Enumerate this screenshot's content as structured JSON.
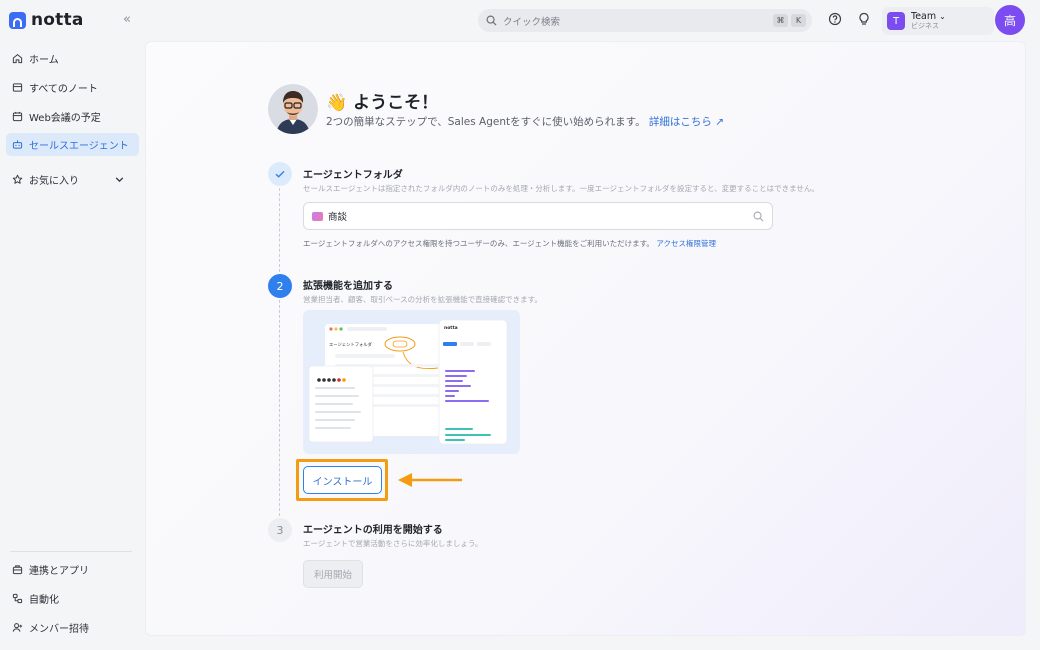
{
  "app": {
    "logo_text": "notta",
    "brand_color": "#3b6cf6",
    "accent_color": "#2f6fd8"
  },
  "topbar": {
    "search_placeholder": "クイック検索",
    "shortcut_keys": [
      "⌘",
      "K"
    ],
    "team_initial": "T",
    "team_name": "Team",
    "team_plan": "ビジネス",
    "user_initial": "高"
  },
  "sidebar": {
    "items": [
      {
        "label": "ホーム",
        "icon": "home-icon"
      },
      {
        "label": "すべてのノート",
        "icon": "notes-icon"
      },
      {
        "label": "Web会議の予定",
        "icon": "calendar-icon"
      },
      {
        "label": "セールスエージェント",
        "icon": "robot-icon",
        "active": true
      },
      {
        "label": "お気に入り",
        "icon": "star-icon"
      }
    ],
    "bottom_items": [
      {
        "label": "連携とアプリ",
        "icon": "apps-icon"
      },
      {
        "label": "自動化",
        "icon": "automation-icon"
      },
      {
        "label": "メンバー招待",
        "icon": "invite-icon"
      }
    ]
  },
  "main": {
    "welcome_title": "👋 ようこそ！",
    "welcome_subtitle": "2つの簡単なステップで、Sales Agentをすぐに使い始められます。",
    "welcome_link": "詳細はこちら ↗",
    "steps": [
      {
        "number": "✓",
        "title": "エージェントフォルダ",
        "desc": "セールスエージェントは指定されたフォルダ内のノートのみを処理・分析します。一度エージェントフォルダを設定すると、変更することはできません。",
        "folder_value": "商談",
        "access_note": "エージェントフォルダへのアクセス権限を持つユーザーのみ、エージェント機能をご利用いただけます。",
        "access_link": "アクセス権限管理"
      },
      {
        "number": "2",
        "title": "拡張機能を追加する",
        "desc": "営業担当者、顧客、取引ベースの分析を拡張機能で直接確認できます。",
        "install_label": "インストール",
        "preview": {
          "folder_label": "エージェントフォルダ",
          "panel_logo": "notta"
        }
      },
      {
        "number": "3",
        "title": "エージェントの利用を開始する",
        "desc": "エージェントで営業活動をさらに効率化しましょう。",
        "start_label": "利用開始"
      }
    ]
  }
}
